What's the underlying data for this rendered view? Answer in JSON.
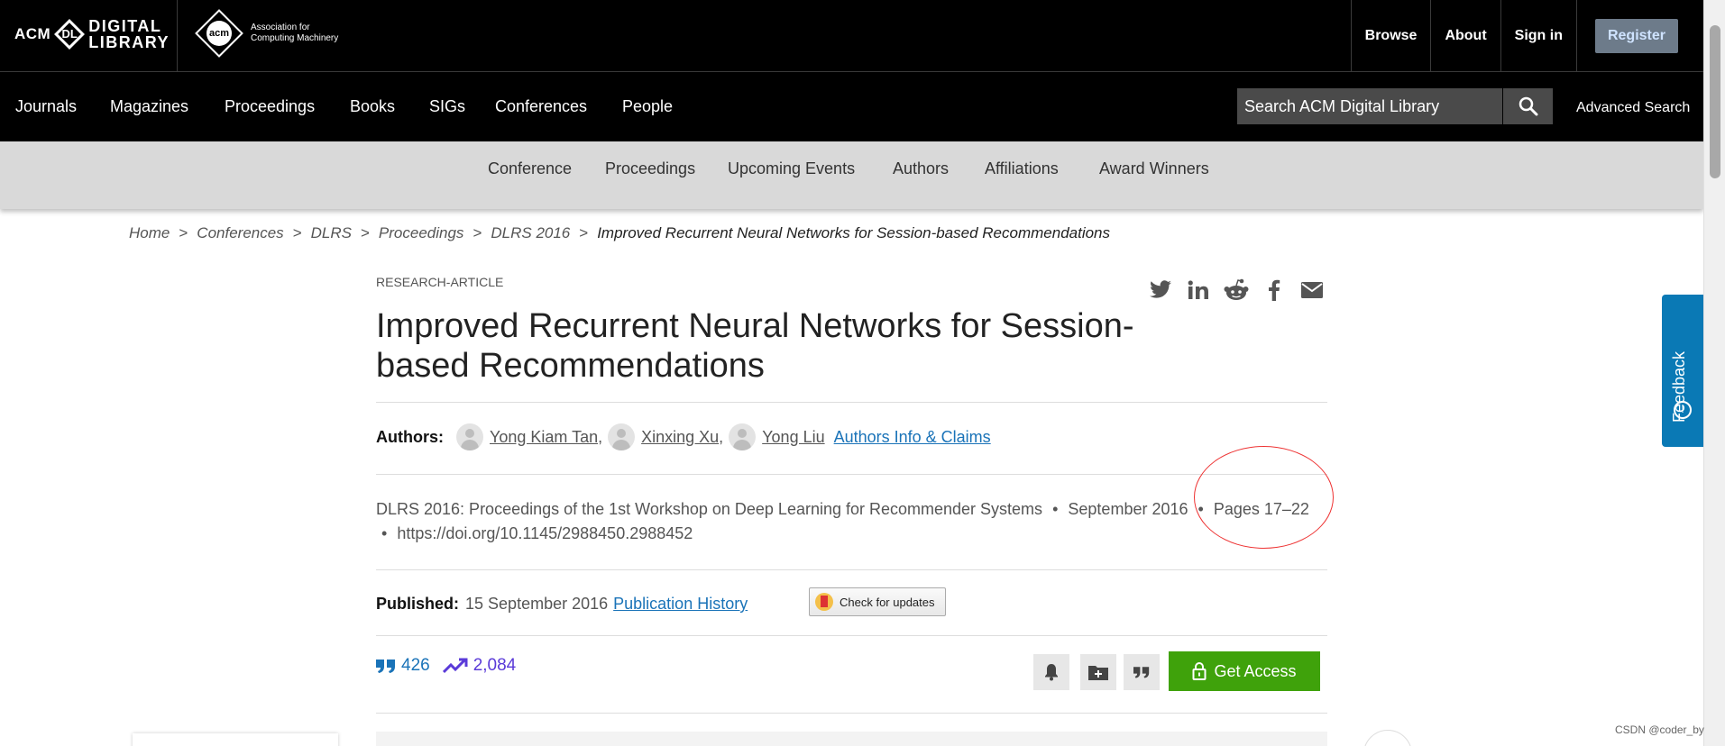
{
  "brand": {
    "dl_acm": "ACM",
    "dl_badge": "DL",
    "dl_line1": "DIGITAL",
    "dl_line2": "LIBRARY",
    "acm_badge": "acm",
    "acm_line1": "Association for",
    "acm_line2": "Computing Machinery"
  },
  "top_links": {
    "browse": "Browse",
    "about": "About",
    "sign_in": "Sign in",
    "register": "Register"
  },
  "main_nav": {
    "journals": "Journals",
    "magazines": "Magazines",
    "proceedings": "Proceedings",
    "books": "Books",
    "sigs": "SIGs",
    "conferences": "Conferences",
    "people": "People"
  },
  "search": {
    "placeholder": "Search ACM Digital Library",
    "advanced": "Advanced Search"
  },
  "sub_nav": {
    "conference": "Conference",
    "proceedings": "Proceedings",
    "upcoming": "Upcoming Events",
    "authors": "Authors",
    "affiliations": "Affiliations",
    "awards": "Award Winners"
  },
  "breadcrumb": {
    "home": "Home",
    "conferences": "Conferences",
    "dlrs": "DLRS",
    "proceedings": "Proceedings",
    "dlrs2016": "DLRS 2016",
    "current": "Improved Recurrent Neural Networks for Session-based Recommendations",
    "separator": ">"
  },
  "article": {
    "type": "RESEARCH-ARTICLE",
    "title": "Improved Recurrent Neural Networks for Session-based Recommendations",
    "authors_label": "Authors:",
    "authors": [
      "Yong Kiam Tan",
      "Xinxing Xu",
      "Yong Liu"
    ],
    "comma": ",",
    "authors_info": "Authors Info & Claims",
    "proceedings": "DLRS 2016: Proceedings of the 1st Workshop on Deep Learning for Recommender Systems",
    "date": "September 2016",
    "pages": "Pages 17–22",
    "bullet": "•",
    "doi": "https://doi.org/10.1145/2988450.2988452",
    "published_label": "Published:",
    "published_date": "15 September 2016",
    "publication_history": "Publication History",
    "check_updates": "Check for updates",
    "citations": "426",
    "downloads": "2,084",
    "get_access": "Get Access"
  },
  "feedback": {
    "label": "Feedback"
  },
  "watermark": "CSDN @coder_by",
  "colors": {
    "accent": "#1a73b8",
    "access_green": "#3fa20b",
    "feedback_blue": "#0a79b5",
    "annotation_red": "#e33"
  }
}
